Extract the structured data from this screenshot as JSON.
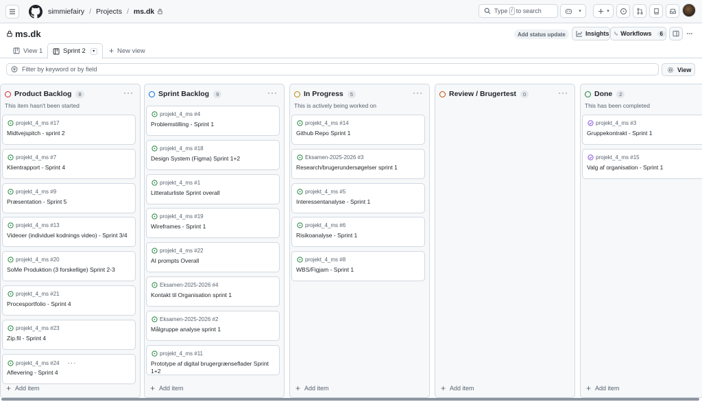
{
  "header": {
    "breadcrumb": [
      "simmiefairy",
      "Projects",
      "ms.dk"
    ],
    "search_prefix": "Type",
    "search_key": "/",
    "search_suffix": "to search"
  },
  "project": {
    "title": "ms.dk",
    "status_update": "Add status update",
    "insights": "Insights",
    "workflows": "Workflows",
    "workflows_count": "6"
  },
  "tabs": [
    {
      "label": "View 1"
    },
    {
      "label": "Sprint 2"
    },
    {
      "label": "New view"
    }
  ],
  "filter": {
    "placeholder": "Filter by keyword or by field",
    "view_button": "View"
  },
  "colors": {
    "todo": "#d1242f",
    "sprint": "#0969da",
    "progress": "#bf8700",
    "review": "#bc4c00",
    "done": "#1a7f37",
    "open_issue": "#1a7f37",
    "closed_issue": "#8250df"
  },
  "board": {
    "add_item": "Add item",
    "columns": [
      {
        "name": "Product Backlog",
        "count": "8",
        "description": "This item hasn't been started",
        "cards": [
          {
            "meta": "projekt_4_ms #17",
            "title": "Midtvejspitch - sprint 2"
          },
          {
            "meta": "projekt_4_ms #7",
            "title": "Klientrapport - Sprint 4"
          },
          {
            "meta": "projekt_4_ms #9",
            "title": "Præsentation - Sprint 5"
          },
          {
            "meta": "projekt_4_ms #13",
            "title": "Videoer (individuel kodnings video) - Sprint 3/4"
          },
          {
            "meta": "projekt_4_ms #20",
            "title": "SoMe Produktion (3 forskellige) Sprint 2-3"
          },
          {
            "meta": "projekt_4_ms #21",
            "title": "Procesportfolio - Sprint 4"
          },
          {
            "meta": "projekt_4_ms #23",
            "title": "Zip.fil - Sprint 4"
          },
          {
            "meta": "projekt_4_ms #24",
            "title": "Aflevering - Sprint 4"
          }
        ]
      },
      {
        "name": "Sprint Backlog",
        "count": "9",
        "description": "",
        "cards": [
          {
            "meta": "projekt_4_ms #4",
            "title": "Problemstilling - Sprint 1"
          },
          {
            "meta": "projekt_4_ms #18",
            "title": "Design System (Figma) Sprint 1+2"
          },
          {
            "meta": "projekt_4_ms #1",
            "title": "Litteraturliste Sprint overall"
          },
          {
            "meta": "projekt_4_ms #19",
            "title": "Wireframes - Sprint 1"
          },
          {
            "meta": "projekt_4_ms #22",
            "title": "AI prompts Overall"
          },
          {
            "meta": "Eksamen-2025-2026 #4",
            "title": "Kontakt til Organisation sprint 1"
          },
          {
            "meta": "Eksamen-2025-2026 #2",
            "title": "Målgruppe analyse sprint 1"
          },
          {
            "meta": "projekt_4_ms #11",
            "title": "Prototype af digital brugergrænseflader Sprint 1+2"
          }
        ]
      },
      {
        "name": "In Progress",
        "count": "5",
        "description": "This is actively being worked on",
        "cards": [
          {
            "meta": "projekt_4_ms #14",
            "title": "Github Repo Sprint 1"
          },
          {
            "meta": "Eksamen-2025-2026 #3",
            "title": "Research/brugerundersøgelser sprint 1"
          },
          {
            "meta": "projekt_4_ms #5",
            "title": "Interessentanalyse - Sprint 1"
          },
          {
            "meta": "projekt_4_ms #6",
            "title": "Risikoanalyse - Sprint 1"
          },
          {
            "meta": "projekt_4_ms #8",
            "title": "WBS/Figjam - Sprint 1"
          }
        ]
      },
      {
        "name": "Review / Brugertest",
        "count": "0",
        "description": "",
        "cards": []
      },
      {
        "name": "Done",
        "count": "2",
        "description": "This has been completed",
        "cards": [
          {
            "meta": "projekt_4_ms #3",
            "title": "Gruppekontrakt - Sprint 1"
          },
          {
            "meta": "projekt_4_ms #15",
            "title": "Valg af organisation - Sprint 1"
          }
        ]
      }
    ]
  }
}
